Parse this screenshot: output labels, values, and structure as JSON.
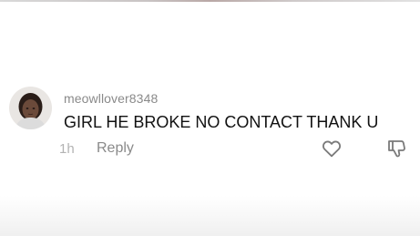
{
  "comment": {
    "username": "meowllover8348",
    "text": "GIRL HE BROKE NO CONTACT THANK U",
    "timestamp": "1h",
    "reply_label": "Reply"
  },
  "icons": {
    "like": "heart-icon",
    "dislike": "thumbs-down-icon"
  },
  "colors": {
    "username": "#8a8a8a",
    "text": "#111111",
    "timestamp": "#b3b3b3",
    "reply": "#8a8a8a",
    "icons": "#7a7a7a"
  }
}
